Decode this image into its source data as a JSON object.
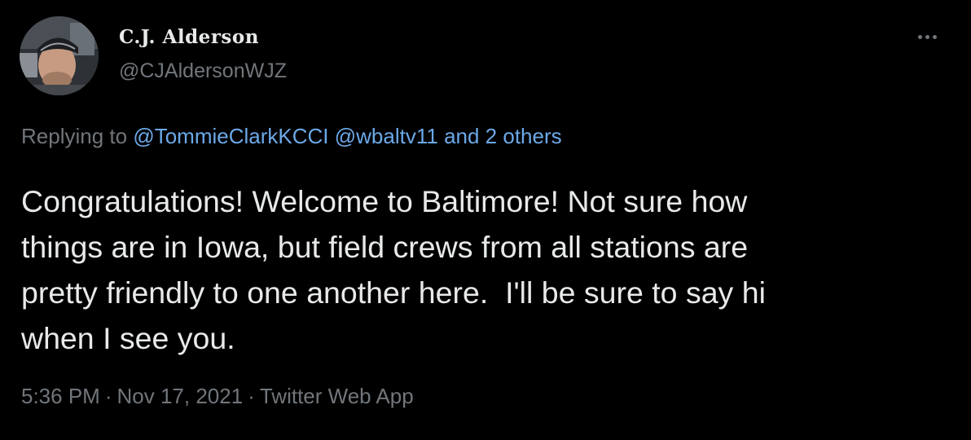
{
  "author": {
    "display_name": "C.J. Alderson",
    "handle": "@CJAldersonWJZ"
  },
  "menu": {
    "icon": "more-horizontal-icon"
  },
  "reply_context": {
    "prefix": "Replying to",
    "mention_1": "@TommieClarkKCCI",
    "mention_2": "@wbaltv11",
    "others": "and 2 others"
  },
  "tweet": {
    "text": "Congratulations! Welcome to Baltimore! Not sure how\nthings are in Iowa, but field crews from all stations are\npretty friendly to one another here.  I'll be sure to say hi\nwhen I see you."
  },
  "meta": {
    "time": "5:36 PM",
    "separator": "·",
    "date": "Nov 17, 2021",
    "source": "Twitter Web App"
  },
  "colors": {
    "background": "#000000",
    "text": "#e7e9ea",
    "secondary": "#71767b",
    "link": "#6ca9e8"
  }
}
